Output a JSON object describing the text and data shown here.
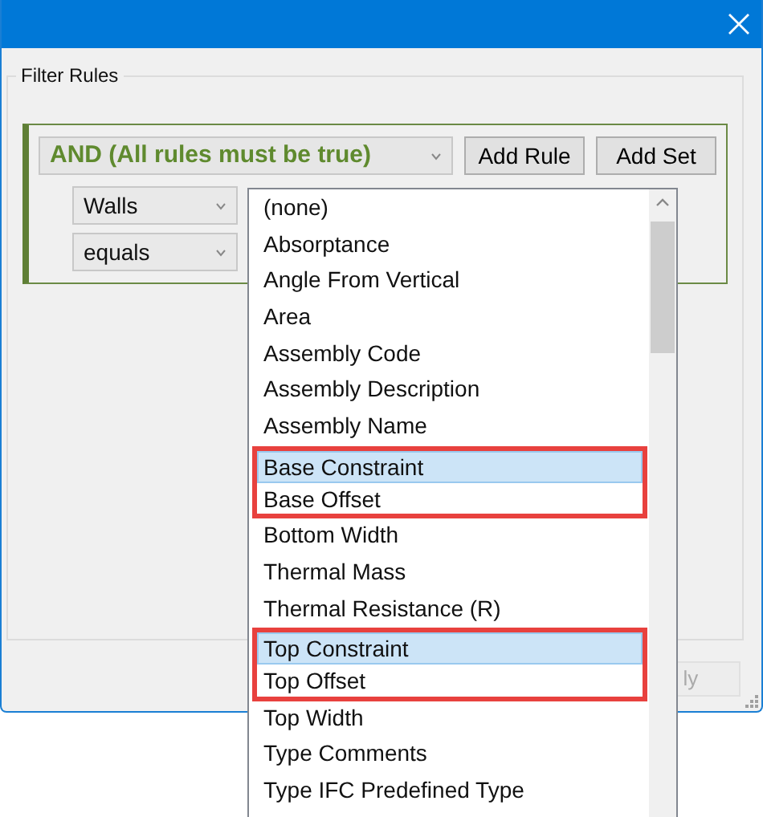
{
  "group": {
    "title": "Filter Rules"
  },
  "rule_set": {
    "operator": "AND (All rules must be true)",
    "buttons": [
      "Add Rule",
      "Add Set"
    ],
    "category": "Walls",
    "condition": "equals"
  },
  "parameter_list": {
    "expanded": true,
    "items": [
      {
        "label": "(none)",
        "selected": false,
        "flagged": false
      },
      {
        "label": "Absorptance",
        "selected": false,
        "flagged": false
      },
      {
        "label": "Angle From Vertical",
        "selected": false,
        "flagged": false
      },
      {
        "label": "Area",
        "selected": false,
        "flagged": false
      },
      {
        "label": "Assembly Code",
        "selected": false,
        "flagged": false
      },
      {
        "label": "Assembly Description",
        "selected": false,
        "flagged": false
      },
      {
        "label": "Assembly Name",
        "selected": false,
        "flagged": false
      },
      {
        "label": "Base Constraint",
        "selected": true,
        "flagged": true
      },
      {
        "label": "Base Offset",
        "selected": false,
        "flagged": true
      },
      {
        "label": "Bottom Width",
        "selected": false,
        "flagged": false
      },
      {
        "label": "Thermal Mass",
        "selected": false,
        "flagged": false
      },
      {
        "label": "Thermal Resistance (R)",
        "selected": false,
        "flagged": false
      },
      {
        "label": "Top Constraint",
        "selected": true,
        "flagged": true
      },
      {
        "label": "Top Offset",
        "selected": false,
        "flagged": true
      },
      {
        "label": "Top Width",
        "selected": false,
        "flagged": false
      },
      {
        "label": "Type Comments",
        "selected": false,
        "flagged": false
      },
      {
        "label": "Type IFC Predefined Type",
        "selected": false,
        "flagged": false
      }
    ]
  },
  "footer_button": {
    "label": "ly",
    "disabled": true
  }
}
